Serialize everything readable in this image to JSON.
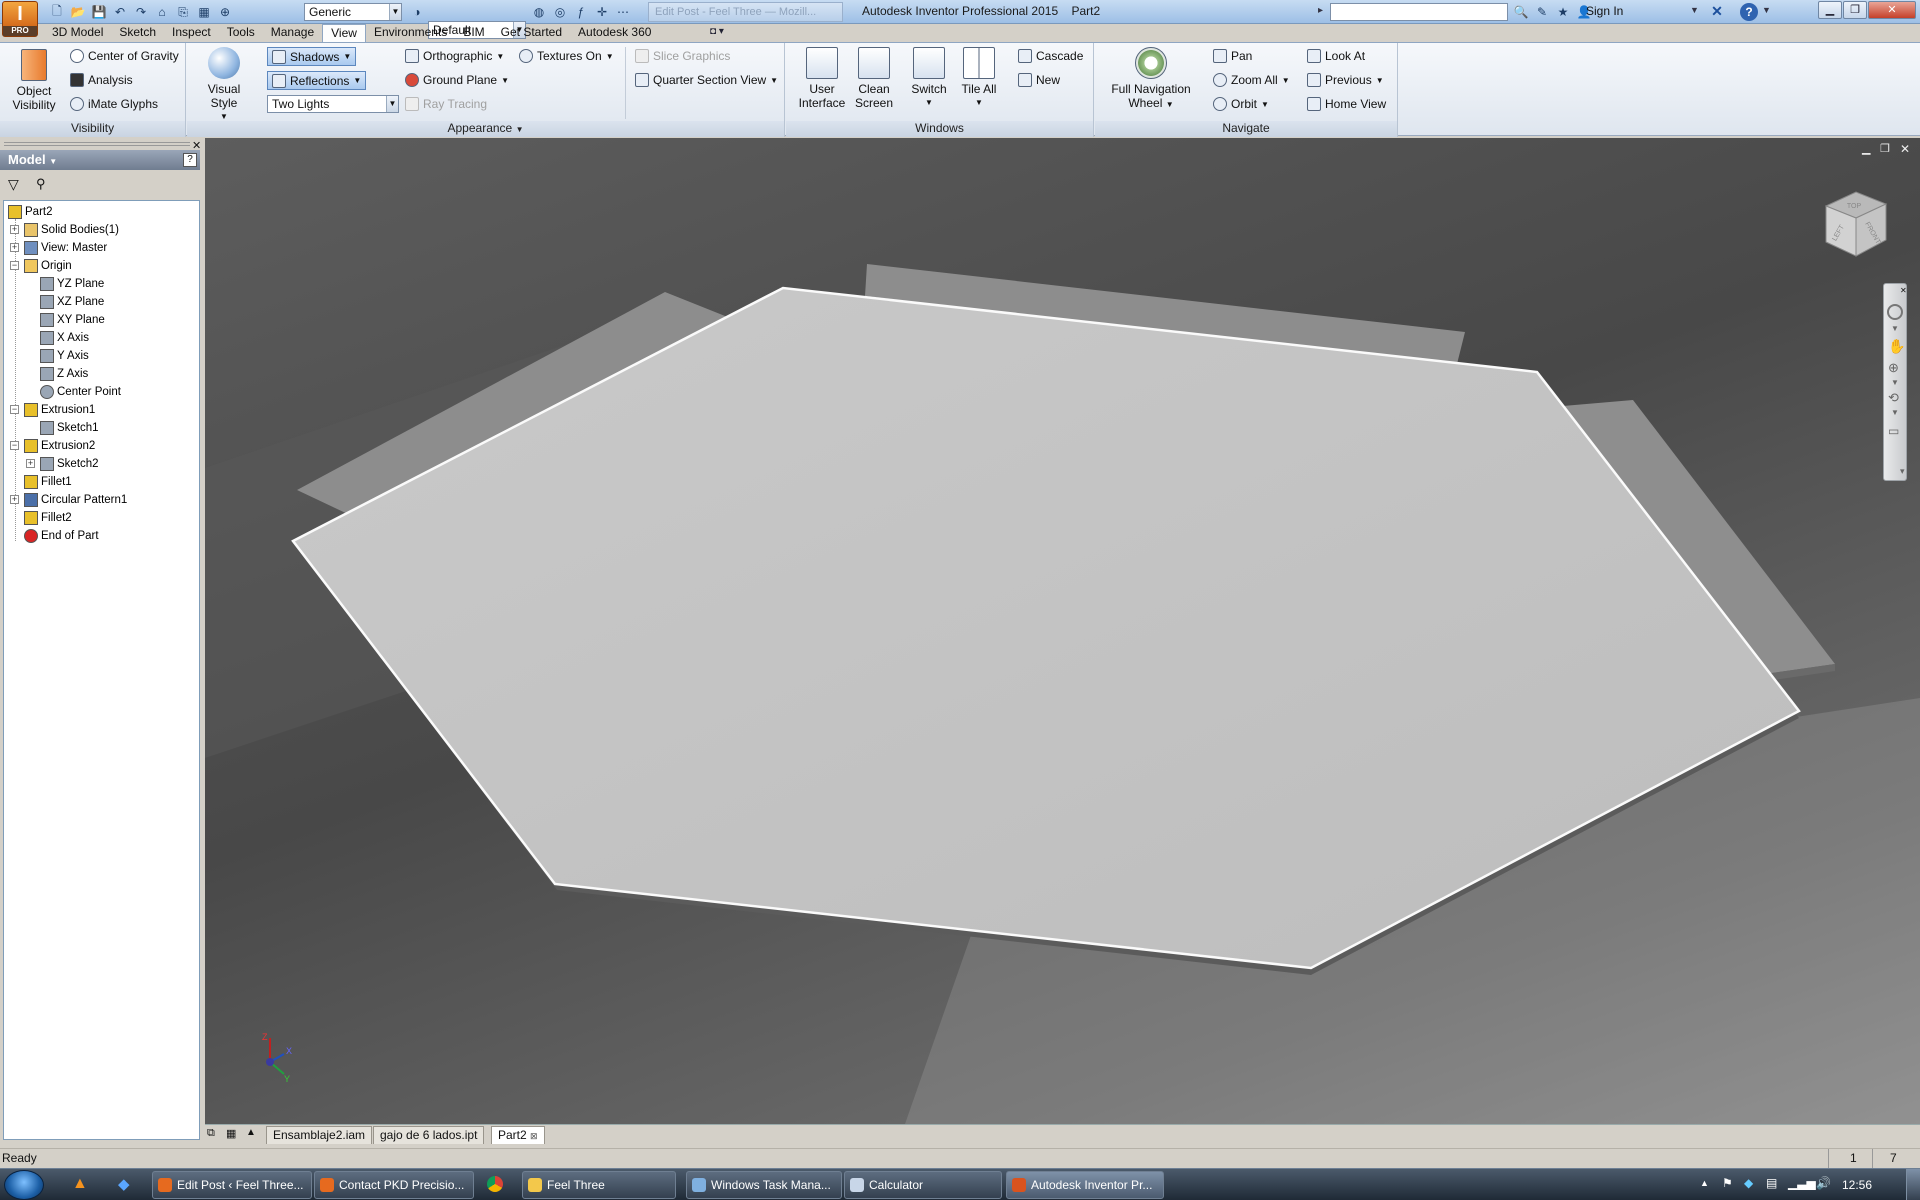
{
  "app": {
    "logo_text": "I",
    "logo_sub": "PRO",
    "window_title": "Autodesk Inventor Professional 2015",
    "document_name": "Part2",
    "faded_tab_title": "Edit Post - Feel Three — Mozill...",
    "sign_in": "Sign In"
  },
  "qat": {
    "material_combo": "Generic",
    "appearance_combo": "Default"
  },
  "menu_tabs": [
    {
      "label": "3D Model"
    },
    {
      "label": "Sketch"
    },
    {
      "label": "Inspect"
    },
    {
      "label": "Tools"
    },
    {
      "label": "Manage"
    },
    {
      "label": "View",
      "active": true
    },
    {
      "label": "Environments"
    },
    {
      "label": "BIM"
    },
    {
      "label": "Get Started"
    },
    {
      "label": "Autodesk 360"
    }
  ],
  "ribbon": {
    "visibility": {
      "label": "Visibility",
      "object_visibility": "Object Visibility",
      "center_of_gravity": "Center of Gravity",
      "analysis": "Analysis",
      "imate_glyphs": "iMate Glyphs"
    },
    "appearance": {
      "label": "Appearance",
      "visual_style": "Visual Style",
      "shadows": "Shadows",
      "reflections": "Reflections",
      "lighting": "Two Lights",
      "orthographic": "Orthographic",
      "ground_plane": "Ground Plane",
      "ray_tracing": "Ray Tracing",
      "textures_on": "Textures On",
      "slice_graphics": "Slice Graphics",
      "quarter_section_view": "Quarter Section View"
    },
    "windows": {
      "label": "Windows",
      "user_interface": "User Interface",
      "clean_screen": "Clean Screen",
      "switch": "Switch",
      "tile_all": "Tile All",
      "cascade": "Cascade",
      "new": "New"
    },
    "navigate": {
      "label": "Navigate",
      "full_navigation_wheel": "Full Navigation Wheel",
      "pan": "Pan",
      "zoom_all": "Zoom All",
      "orbit": "Orbit",
      "look_at": "Look At",
      "previous": "Previous",
      "home_view": "Home View"
    }
  },
  "browser": {
    "title": "Model",
    "tree": [
      {
        "label": "Part2",
        "icon": "part-icon",
        "color": "#e8c02a"
      },
      {
        "label": "Solid Bodies(1)",
        "icon": "folder-icon",
        "color": "#e9c46a"
      },
      {
        "label": "View: Master",
        "icon": "view-icon",
        "color": "#6f8fbf"
      },
      {
        "label": "Origin",
        "icon": "folder-open-icon",
        "color": "#f0c75e"
      },
      {
        "label": "YZ Plane",
        "icon": "plane-icon",
        "color": "#9aa6b5"
      },
      {
        "label": "XZ Plane",
        "icon": "plane-icon",
        "color": "#9aa6b5"
      },
      {
        "label": "XY Plane",
        "icon": "plane-icon",
        "color": "#9aa6b5"
      },
      {
        "label": "X Axis",
        "icon": "axis-icon",
        "color": "#9aa6b5"
      },
      {
        "label": "Y Axis",
        "icon": "axis-icon",
        "color": "#9aa6b5"
      },
      {
        "label": "Z Axis",
        "icon": "axis-icon",
        "color": "#9aa6b5"
      },
      {
        "label": "Center Point",
        "icon": "point-icon",
        "color": "#9aa6b5"
      },
      {
        "label": "Extrusion1",
        "icon": "extrusion-icon",
        "color": "#e8c02a"
      },
      {
        "label": "Sketch1",
        "icon": "sketch-icon",
        "color": "#9aa6b5"
      },
      {
        "label": "Extrusion2",
        "icon": "extrusion-icon",
        "color": "#e8c02a"
      },
      {
        "label": "Sketch2",
        "icon": "sketch-icon",
        "color": "#9aa6b5"
      },
      {
        "label": "Fillet1",
        "icon": "fillet-icon",
        "color": "#e8c02a"
      },
      {
        "label": "Circular Pattern1",
        "icon": "pattern-icon",
        "color": "#4b6fa8"
      },
      {
        "label": "Fillet2",
        "icon": "fillet-icon",
        "color": "#e8c02a"
      },
      {
        "label": "End of Part",
        "icon": "end-of-part-icon",
        "color": "#d92525"
      }
    ]
  },
  "document_tabs": [
    {
      "label": "Ensamblaje2.iam"
    },
    {
      "label": "gajo de 6 lados.ipt"
    },
    {
      "label": "Part2",
      "active": true
    }
  ],
  "status": {
    "text": "Ready",
    "count_a": "1",
    "count_b": "7"
  },
  "taskbar": {
    "items": [
      {
        "label": "Edit Post ‹ Feel Three...",
        "icon_color": "#e66a1f"
      },
      {
        "label": "Contact PKD Precisio...",
        "icon_color": "#e66a1f"
      },
      {
        "label": "Feel Three",
        "icon_color": "#f3c84b"
      },
      {
        "label": "Windows Task Mana...",
        "icon_color": "#7fb0e0"
      },
      {
        "label": "Calculator",
        "icon_color": "#c8d6e8"
      },
      {
        "label": "Autodesk Inventor Pr...",
        "icon_color": "#d9531e",
        "active": true
      }
    ],
    "clock": "12:56"
  },
  "viewcube": {
    "faces": [
      "TOP",
      "LEFT",
      "FRONT"
    ]
  },
  "triad": {
    "x": "X",
    "y": "Y",
    "z": "Z"
  },
  "colors": {
    "ribbon_accent": "#5c87be",
    "part_face": "#c6c6c6",
    "viewport_bg": "#4f4f4f"
  }
}
